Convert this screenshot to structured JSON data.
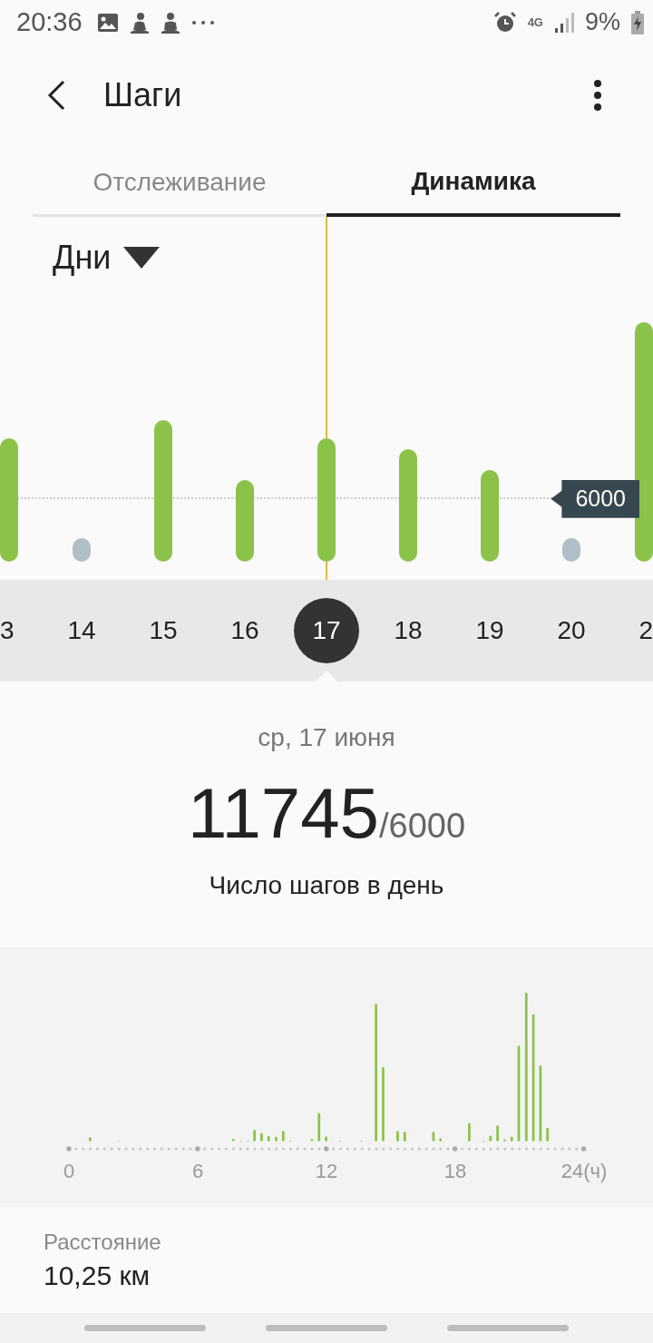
{
  "status_bar": {
    "time": "20:36",
    "network": "4G",
    "battery": "9%"
  },
  "header": {
    "title": "Шаги"
  },
  "tabs": [
    {
      "label": "Отслеживание",
      "selected": false
    },
    {
      "label": "Динамика",
      "selected": true
    }
  ],
  "period": {
    "label": "Дни"
  },
  "chart": {
    "goal_label": "6000"
  },
  "days": [
    {
      "label": "3",
      "kind": "bar",
      "selected": false
    },
    {
      "label": "14",
      "kind": "empty",
      "selected": false
    },
    {
      "label": "15",
      "kind": "bar",
      "selected": false
    },
    {
      "label": "16",
      "kind": "bar",
      "selected": false
    },
    {
      "label": "17",
      "kind": "bar",
      "selected": true
    },
    {
      "label": "18",
      "kind": "bar",
      "selected": false
    },
    {
      "label": "19",
      "kind": "bar",
      "selected": false
    },
    {
      "label": "20",
      "kind": "empty",
      "selected": false
    },
    {
      "label": "2",
      "kind": "bar",
      "selected": false
    }
  ],
  "summary": {
    "date": "ср, 17 июня",
    "steps": "11745",
    "goal": "/6000",
    "caption": "Число шагов в день"
  },
  "hourly": {
    "axis_labels": [
      "0",
      "6",
      "12",
      "18",
      "24(ч)"
    ]
  },
  "distance": {
    "label": "Расстояние",
    "value": "10,25 км"
  }
}
